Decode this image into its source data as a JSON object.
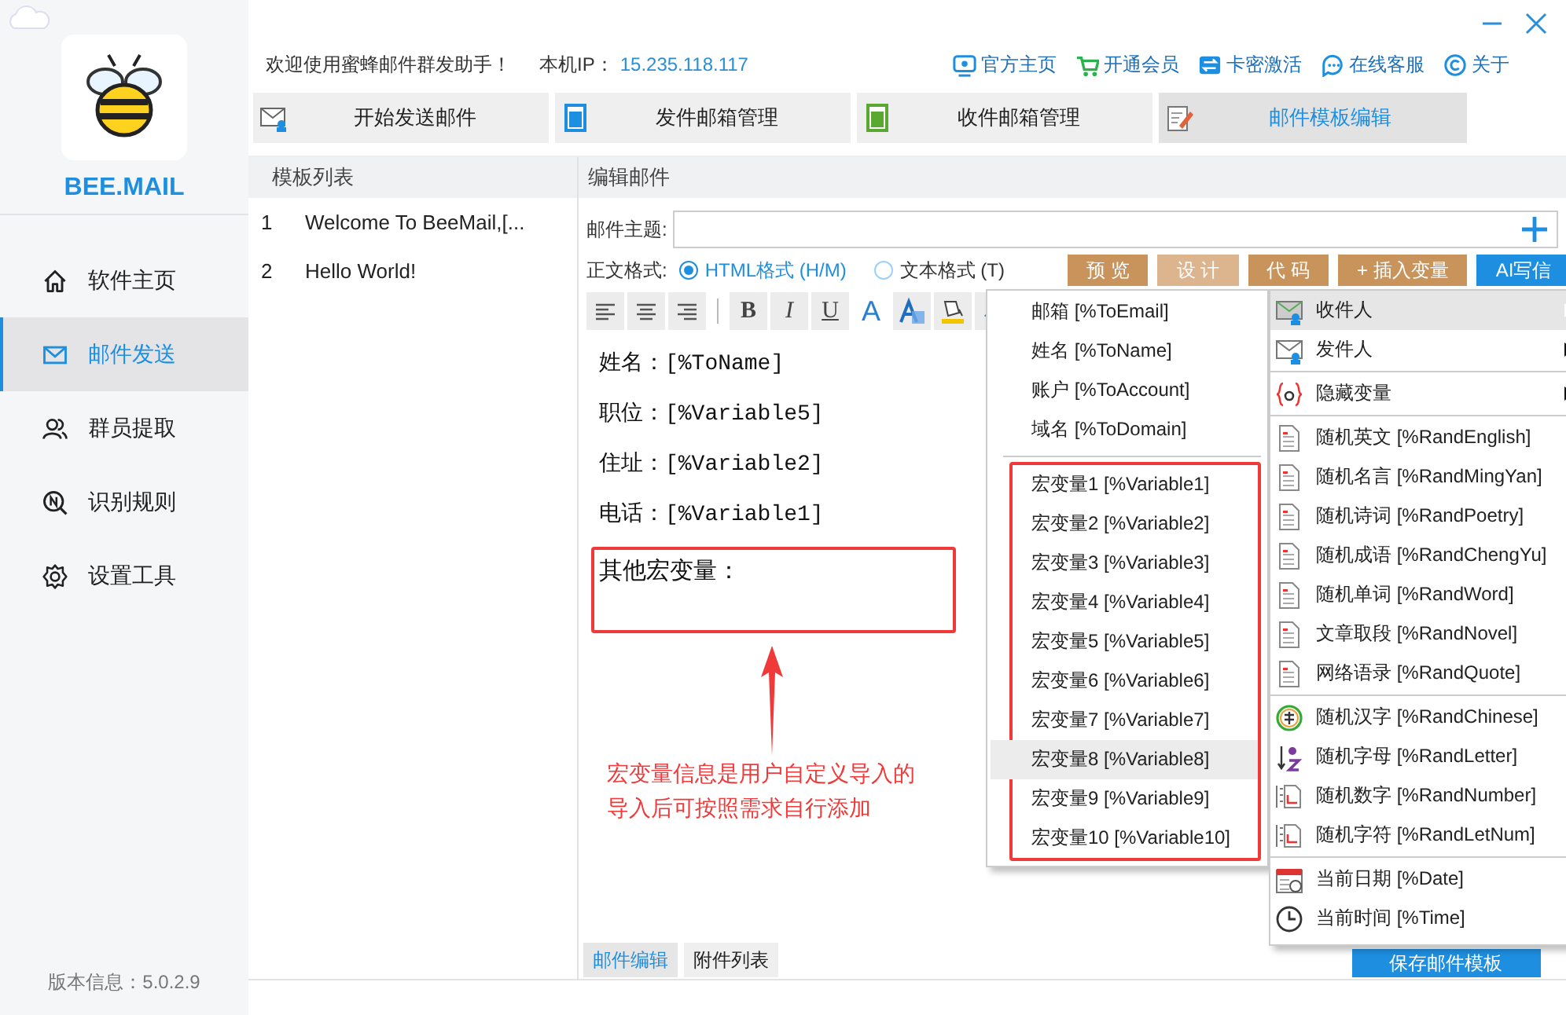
{
  "sidebar": {
    "logo_text": "BEE.MAIL",
    "items": [
      {
        "label": "软件主页",
        "selected": false
      },
      {
        "label": "邮件发送",
        "selected": true
      },
      {
        "label": "群员提取",
        "selected": false
      },
      {
        "label": "识别规则",
        "selected": false
      },
      {
        "label": "设置工具",
        "selected": false
      }
    ],
    "version": "版本信息：5.0.2.9"
  },
  "top_bar": {
    "welcome": "欢迎使用蜜蜂邮件群发助手！",
    "ip_label": "本机IP：",
    "ip": "15.235.118.117",
    "links": [
      "官方主页",
      "开通会员",
      "卡密激活",
      "在线客服",
      "关于"
    ]
  },
  "tabs": [
    {
      "label": "开始发送邮件",
      "selected": false
    },
    {
      "label": "发件邮箱管理",
      "selected": false
    },
    {
      "label": "收件邮箱管理",
      "selected": false
    },
    {
      "label": "邮件模板编辑",
      "selected": true
    }
  ],
  "template_list": {
    "title": "模板列表",
    "rows": [
      {
        "index": "1",
        "name": "Welcome To BeeMail,[..."
      },
      {
        "index": "2",
        "name": "Hello World!"
      }
    ]
  },
  "editor": {
    "title": "编辑邮件",
    "subject_label": "邮件主题:",
    "format_label": "正文格式:",
    "formats": [
      {
        "label": "HTML格式 (H/M)",
        "selected": true
      },
      {
        "label": "文本格式 (T)",
        "selected": false
      }
    ],
    "buttons": [
      {
        "label": "预 览",
        "kind": "action",
        "disabled": false
      },
      {
        "label": "设 计",
        "kind": "action",
        "disabled": true
      },
      {
        "label": "代 码",
        "kind": "action",
        "disabled": false
      },
      {
        "label": "+ 插入变量",
        "kind": "action",
        "disabled": false
      },
      {
        "label": "AI写信",
        "kind": "primary",
        "disabled": false
      }
    ],
    "toolbar": [
      {
        "kind": "icon"
      },
      {
        "kind": "icon"
      },
      {
        "kind": "icon"
      },
      {
        "kind": "separator"
      },
      {
        "kind": "glyph",
        "text": "B"
      },
      {
        "kind": "glyph",
        "text": "I"
      },
      {
        "kind": "glyph",
        "text": "U"
      },
      {
        "kind": "glyph",
        "text": "A"
      },
      {
        "kind": "icon"
      },
      {
        "kind": "icon"
      },
      {
        "kind": "icon"
      }
    ],
    "body_lines": [
      "姓名：[%ToName]",
      "职位：[%Variable5]",
      "住址：[%Variable2]",
      "电话：[%Variable1]"
    ],
    "highlight_text": "其他宏变量：",
    "annotation": [
      "宏变量信息是用户自定义导入的",
      "导入后可按照需求自行添加"
    ],
    "bottom_tabs": [
      {
        "label": "邮件编辑",
        "selected": true
      },
      {
        "label": "附件列表",
        "selected": false
      }
    ],
    "save_button": "保存邮件模板"
  },
  "submenu": {
    "groups": [
      {
        "outlined": false,
        "items": [
          {
            "label": "邮箱 [%ToEmail]",
            "selected": false
          },
          {
            "label": "姓名 [%ToName]",
            "selected": false
          },
          {
            "label": "账户 [%ToAccount]",
            "selected": false
          },
          {
            "label": "域名 [%ToDomain]",
            "selected": false
          }
        ]
      },
      {
        "outlined": true,
        "items": [
          {
            "label": "宏变量1 [%Variable1]",
            "selected": false
          },
          {
            "label": "宏变量2 [%Variable2]",
            "selected": false
          },
          {
            "label": "宏变量3 [%Variable3]",
            "selected": false
          },
          {
            "label": "宏变量4 [%Variable4]",
            "selected": false
          },
          {
            "label": "宏变量5 [%Variable5]",
            "selected": false
          },
          {
            "label": "宏变量6 [%Variable6]",
            "selected": false
          },
          {
            "label": "宏变量7 [%Variable7]",
            "selected": false
          },
          {
            "label": "宏变量8 [%Variable8]",
            "selected": true
          },
          {
            "label": "宏变量9 [%Variable9]",
            "selected": false
          },
          {
            "label": "宏变量10 [%Variable10]",
            "selected": false
          }
        ]
      }
    ]
  },
  "menu": {
    "groups": [
      [
        {
          "label": "收件人",
          "has_submenu": true,
          "selected": true
        },
        {
          "label": "发件人",
          "has_submenu": true,
          "selected": false
        }
      ],
      [
        {
          "label": "隐藏变量",
          "has_submenu": true,
          "selected": false
        }
      ],
      [
        {
          "label": "随机英文 [%RandEnglish]",
          "has_submenu": false,
          "selected": false
        },
        {
          "label": "随机名言 [%RandMingYan]",
          "has_submenu": false,
          "selected": false
        },
        {
          "label": "随机诗词 [%RandPoetry]",
          "has_submenu": false,
          "selected": false
        },
        {
          "label": "随机成语 [%RandChengYu]",
          "has_submenu": false,
          "selected": false
        },
        {
          "label": "随机单词 [%RandWord]",
          "has_submenu": false,
          "selected": false
        },
        {
          "label": "文章取段 [%RandNovel]",
          "has_submenu": false,
          "selected": false
        },
        {
          "label": "网络语录 [%RandQuote]",
          "has_submenu": false,
          "selected": false
        }
      ],
      [
        {
          "label": "随机汉字 [%RandChinese]",
          "has_submenu": false,
          "selected": false
        },
        {
          "label": "随机字母 [%RandLetter]",
          "has_submenu": false,
          "selected": false
        },
        {
          "label": "随机数字 [%RandNumber]",
          "has_submenu": false,
          "selected": false
        },
        {
          "label": "随机字符 [%RandLetNum]",
          "has_submenu": false,
          "selected": false
        }
      ],
      [
        {
          "label": "当前日期 [%Date]",
          "has_submenu": false,
          "selected": false
        },
        {
          "label": "当前时间 [%Time]",
          "has_submenu": false,
          "selected": false
        }
      ]
    ]
  }
}
